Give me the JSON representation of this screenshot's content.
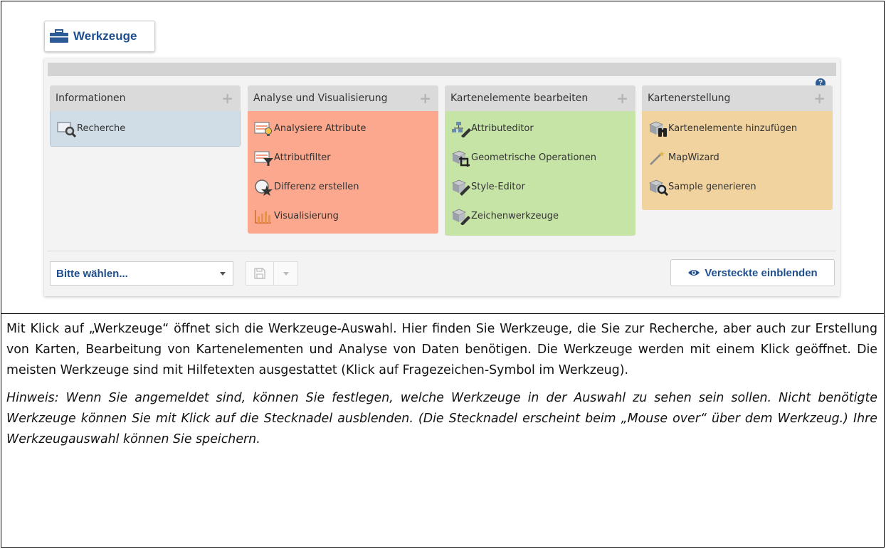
{
  "toolbar": {
    "tools_button_label": "Werkzeuge"
  },
  "panel": {
    "groups": [
      {
        "title": "Informationen",
        "color": "#d0dde6",
        "tools": [
          {
            "label": "Recherche",
            "icon": "magnifier-monitor-icon"
          }
        ]
      },
      {
        "title": "Analyse und Visualisierung",
        "color": "#fba88e",
        "tools": [
          {
            "label": "Analysiere Attribute",
            "icon": "table-bulb-icon"
          },
          {
            "label": "Attributfilter",
            "icon": "table-filter-icon"
          },
          {
            "label": "Differenz erstellen",
            "icon": "circle-star-icon"
          },
          {
            "label": "Visualisierung",
            "icon": "bar-chart-icon"
          }
        ]
      },
      {
        "title": "Kartenelemente bearbeiten",
        "color": "#c7e4a7",
        "tools": [
          {
            "label": "Attributeditor",
            "icon": "hierarchy-pencil-icon"
          },
          {
            "label": "Geometrische Operationen",
            "icon": "cube-crop-icon"
          },
          {
            "label": "Style-Editor",
            "icon": "cube-brush-icon"
          },
          {
            "label": "Zeichenwerkzeuge",
            "icon": "cube-pencil-icon"
          }
        ]
      },
      {
        "title": "Kartenerstellung",
        "color": "#f1d3a0",
        "tools": [
          {
            "label": "Kartenelemente hinzufügen",
            "icon": "cube-binoculars-icon"
          },
          {
            "label": "MapWizard",
            "icon": "magic-wand-icon"
          },
          {
            "label": "Sample generieren",
            "icon": "cube-magnifier-icon"
          }
        ]
      }
    ],
    "help_glyph": "?",
    "plus_glyph": "+",
    "select_value": "Bitte wählen...",
    "show_hidden_label": "Versteckte einblenden"
  },
  "document": {
    "paragraph1": "Mit Klick auf „Werkzeuge“ öffnet sich die Werkzeuge-Auswahl. Hier finden Sie Werkzeuge, die Sie zur Recherche, aber auch zur Erstellung von Karten, Bearbeitung von Kartenelementen und Analyse von Daten benötigen. Die Werkzeuge werden mit einem Klick geöffnet. Die meisten Werkzeuge sind mit Hilfetexten ausgestattet (Klick auf Fragezeichen-Symbol im Werkzeug).",
    "paragraph2": "Hinweis: Wenn Sie angemeldet sind, können Sie festlegen, welche Werkzeuge in der Auswahl zu sehen sein sollen. Nicht benötigte Werkzeuge können Sie mit Klick auf die Stecknadel ausblenden. (Die Stecknadel erscheint beim „Mouse over“ über dem Werkzeug.) Ihre Werkzeugauswahl können Sie speichern."
  },
  "colors": {
    "accent": "#1f4f8f",
    "info_group": "#d0dde6",
    "analysis_group": "#fba88e",
    "edit_group": "#c7e4a7",
    "map_group": "#f1d3a0"
  }
}
